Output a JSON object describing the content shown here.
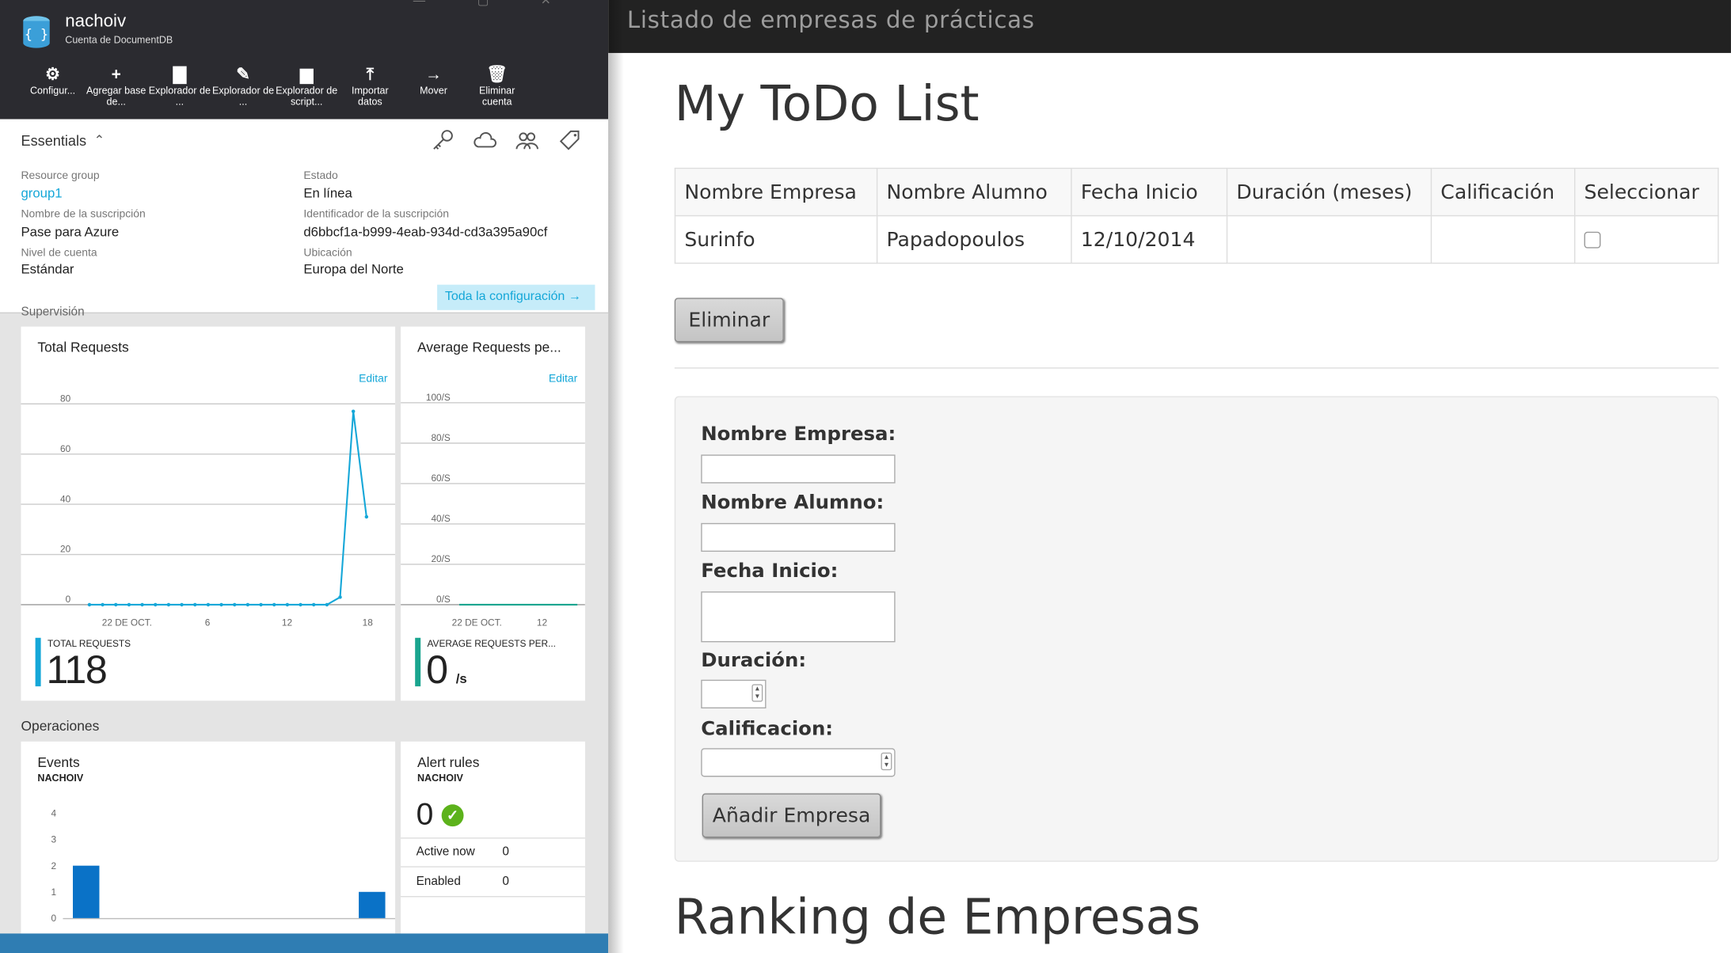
{
  "azure": {
    "account_name": "nachoiv",
    "account_type": "Cuenta de DocumentDB",
    "toolbar": [
      {
        "label": "Configur...",
        "icon": "gear-icon"
      },
      {
        "label": "Agregar base de...",
        "icon": "plus-icon"
      },
      {
        "label": "Explorador de ...",
        "icon": "document-icon"
      },
      {
        "label": "Explorador de ...",
        "icon": "query-icon"
      },
      {
        "label": "Explorador de script...",
        "icon": "script-icon"
      },
      {
        "label": "Importar datos",
        "icon": "upload-icon"
      },
      {
        "label": "Mover",
        "icon": "arrow-right-icon"
      },
      {
        "label": "Eliminar cuenta",
        "icon": "trash-icon"
      }
    ],
    "essentials": {
      "heading": "Essentials",
      "resource_group_label": "Resource group",
      "resource_group": "group1",
      "subscription_name_label": "Nombre de la suscripción",
      "subscription_name": "Pase para Azure",
      "account_level_label": "Nivel de cuenta",
      "account_level": "Estándar",
      "status_label": "Estado",
      "status": "En línea",
      "subscription_id_label": "Identificador de la suscripción",
      "subscription_id": "d6bbcf1a-b999-4eab-934d-cd3a395a90cf",
      "location_label": "Ubicación",
      "location": "Europa del Norte",
      "all_settings": "Toda la configuración"
    },
    "monitoring_label": "Supervisión",
    "operations_label": "Operaciones",
    "total_requests_tile": {
      "title": "Total Requests",
      "edit": "Editar",
      "summary_label": "TOTAL REQUESTS",
      "summary_value": "118"
    },
    "avg_requests_tile": {
      "title": "Average Requests pe...",
      "edit": "Editar",
      "summary_label": "AVERAGE REQUESTS PER...",
      "summary_value": "0",
      "summary_unit": "/s"
    },
    "events_tile": {
      "title": "Events",
      "subtitle": "NACHOIV"
    },
    "alert_tile": {
      "title": "Alert rules",
      "subtitle": "NACHOIV",
      "count": "0",
      "active_label": "Active now",
      "active_value": "0",
      "enabled_label": "Enabled",
      "enabled_value": "0"
    },
    "accent": "#15a7d8",
    "header_bg": "#2b2b30"
  },
  "chart_data": [
    {
      "type": "line",
      "title": "Total Requests",
      "x_ticks": [
        "22 DE OCT.",
        "6",
        "12",
        "18"
      ],
      "y_ticks": [
        "80",
        "60",
        "40",
        "20",
        "0"
      ],
      "ylim": [
        0,
        80
      ],
      "series": [
        {
          "values": [
            0,
            0,
            0,
            0,
            0,
            0,
            0,
            0,
            0,
            0,
            0,
            0,
            0,
            0,
            0,
            0,
            0,
            0,
            0,
            3,
            77,
            35
          ]
        }
      ],
      "color": "#15a7d8"
    },
    {
      "type": "line",
      "title": "Average Requests pe...",
      "x_ticks": [
        "22 DE OCT.",
        "12"
      ],
      "y_ticks": [
        "100/S",
        "80/S",
        "60/S",
        "40/S",
        "20/S",
        "0/S"
      ],
      "ylim": [
        0,
        100
      ],
      "series": [
        {
          "values": [
            0,
            0,
            0,
            0,
            0,
            0,
            0,
            0,
            0,
            0,
            0,
            0,
            0,
            0,
            0,
            0,
            0,
            0,
            0,
            0,
            0,
            0,
            0,
            0,
            0,
            0,
            0,
            0,
            0,
            0
          ]
        }
      ],
      "color": "#1aa58f"
    },
    {
      "type": "bar",
      "title": "Events",
      "y_ticks": [
        "4",
        "3",
        "2",
        "1",
        "0"
      ],
      "ylim": [
        0,
        4
      ],
      "values": [
        2,
        1
      ],
      "color": "#0a72c7"
    }
  ],
  "app": {
    "brand": "Listado de empresas de prácticas",
    "title": "My ToDo List",
    "table": {
      "headers": [
        "Nombre Empresa",
        "Nombre Alumno",
        "Fecha Inicio",
        "Duración (meses)",
        "Calificación",
        "Seleccionar"
      ],
      "rows": [
        {
          "empresa": "Surinfo",
          "alumno": "Papadopoulos",
          "fecha": "12/10/2014",
          "duracion": "",
          "calificacion": ""
        }
      ]
    },
    "delete_button": "Eliminar",
    "form": {
      "empresa_label": "Nombre Empresa:",
      "alumno_label": "Nombre Alumno:",
      "fecha_label": "Fecha Inicio:",
      "duracion_label": "Duración:",
      "calificacion_label": "Calificacion:",
      "submit": "Añadir Empresa"
    },
    "ranking_title": "Ranking de Empresas"
  }
}
